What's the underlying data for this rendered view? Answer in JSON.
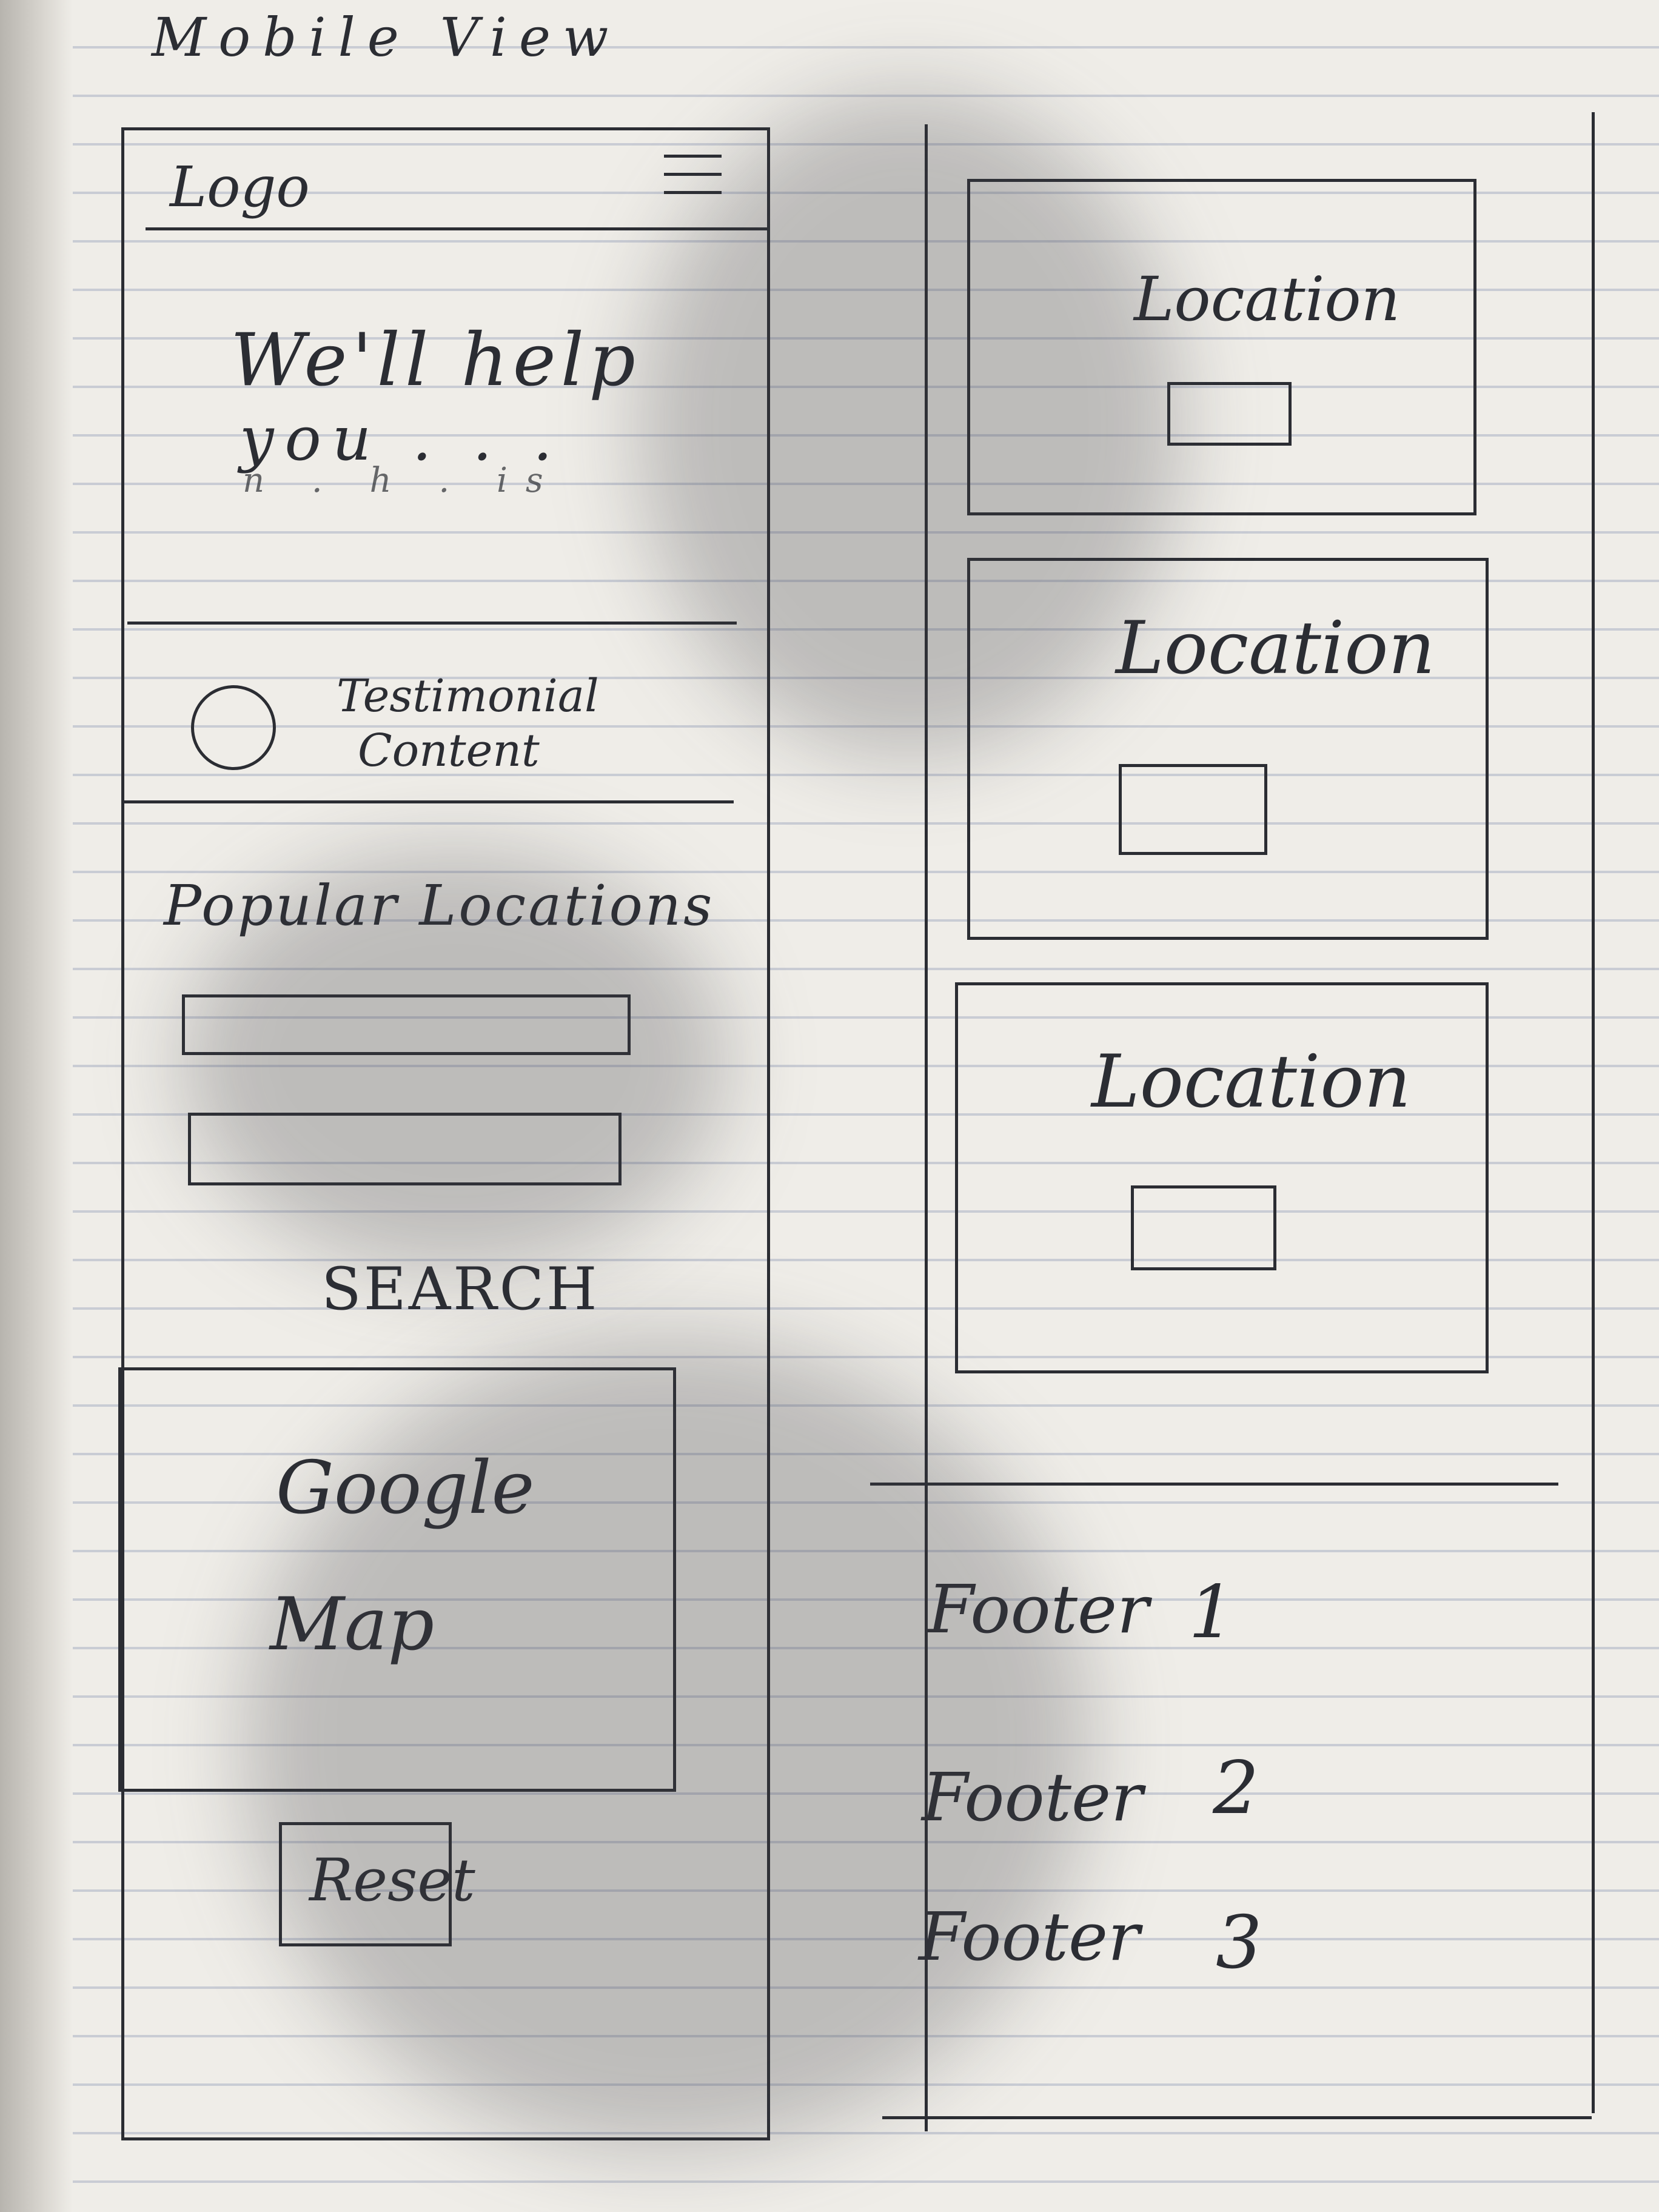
{
  "page_title": "Mobile View",
  "left_column": {
    "logo": "Logo",
    "hero_text_line1": "We'll help",
    "hero_text_line2": "you . . .",
    "hero_text_line3": "n .   h . is",
    "testimonial_line1": "Testimonial",
    "testimonial_line2": "Content",
    "popular_title": "Popular Locations",
    "search_label": "SEARCH",
    "map_line1": "Google",
    "map_line2": "Map",
    "reset_label": "Reset"
  },
  "right_column": {
    "location_cards": [
      {
        "label": "Location"
      },
      {
        "label": "Location"
      },
      {
        "label": "Location"
      }
    ],
    "footer_items": [
      {
        "label": "Footer",
        "number": "1"
      },
      {
        "label": "Footer",
        "number": "2"
      },
      {
        "label": "Footer",
        "number": "3"
      }
    ]
  }
}
